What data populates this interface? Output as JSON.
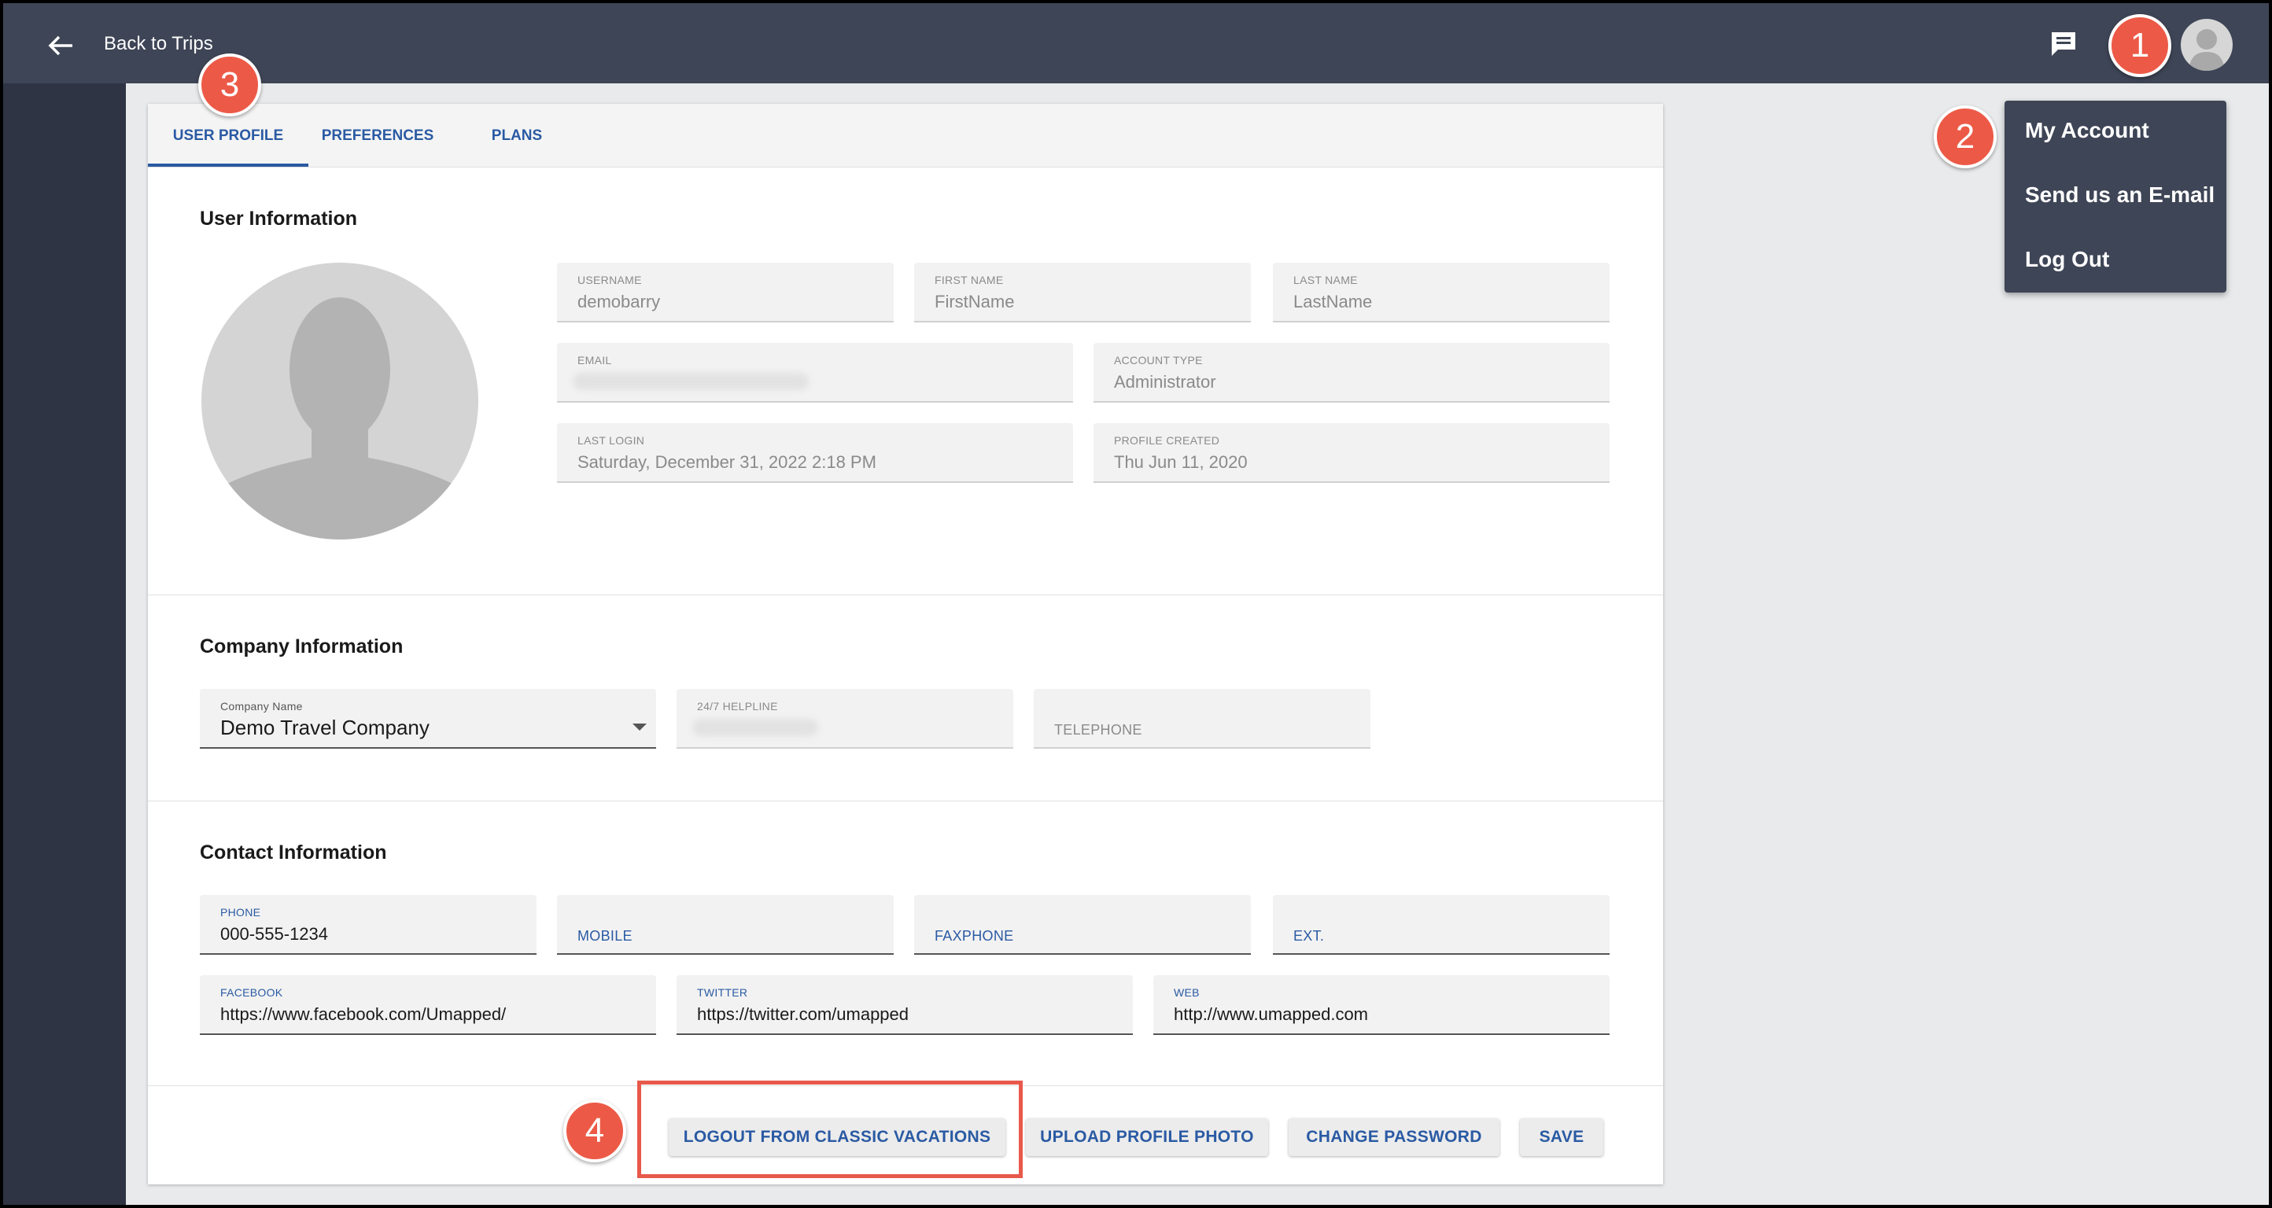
{
  "header": {
    "back_label": "Back to Trips"
  },
  "tabs": [
    {
      "label": "USER PROFILE",
      "active": true
    },
    {
      "label": "PREFERENCES",
      "active": false
    },
    {
      "label": "PLANS",
      "active": false
    }
  ],
  "user_information": {
    "title": "User Information",
    "username": {
      "label": "USERNAME",
      "value": "demobarry"
    },
    "first_name": {
      "label": "FIRST NAME",
      "value": "FirstName"
    },
    "last_name": {
      "label": "LAST NAME",
      "value": "LastName"
    },
    "email": {
      "label": "EMAIL",
      "value": ""
    },
    "account_type": {
      "label": "ACCOUNT TYPE",
      "value": "Administrator"
    },
    "last_login": {
      "label": "LAST LOGIN",
      "value": "Saturday, December 31, 2022 2:18 PM"
    },
    "profile_created": {
      "label": "PROFILE CREATED",
      "value": "Thu Jun 11, 2020"
    }
  },
  "company_information": {
    "title": "Company Information",
    "company_name": {
      "label": "Company Name",
      "value": "Demo Travel Company"
    },
    "helpline": {
      "label": "24/7 HELPLINE",
      "value": ""
    },
    "telephone": {
      "placeholder": "TELEPHONE"
    }
  },
  "contact_information": {
    "title": "Contact Information",
    "phone": {
      "label": "PHONE",
      "value": "000-555-1234"
    },
    "mobile": {
      "placeholder": "MOBILE"
    },
    "faxphone": {
      "placeholder": "FAXPHONE"
    },
    "ext": {
      "placeholder": "EXT."
    },
    "facebook": {
      "label": "FACEBOOK",
      "value": "https://www.facebook.com/Umapped/"
    },
    "twitter": {
      "label": "TWITTER",
      "value": "https://twitter.com/umapped"
    },
    "web": {
      "label": "WEB",
      "value": "http://www.umapped.com"
    }
  },
  "actions": {
    "logout_classic": "LOGOUT FROM CLASSIC VACATIONS",
    "upload_photo": "UPLOAD PROFILE PHOTO",
    "change_password": "CHANGE PASSWORD",
    "save": "SAVE"
  },
  "account_menu": {
    "items": [
      "My Account",
      "Send us an E-mail",
      "Log Out"
    ]
  },
  "annotations": {
    "callout_1": "1",
    "callout_2": "2",
    "callout_3": "3",
    "callout_4": "4"
  },
  "colors": {
    "topbar": "#3e4556",
    "accent_blue": "#2a5aa3",
    "callout_red": "#ec5a47"
  }
}
